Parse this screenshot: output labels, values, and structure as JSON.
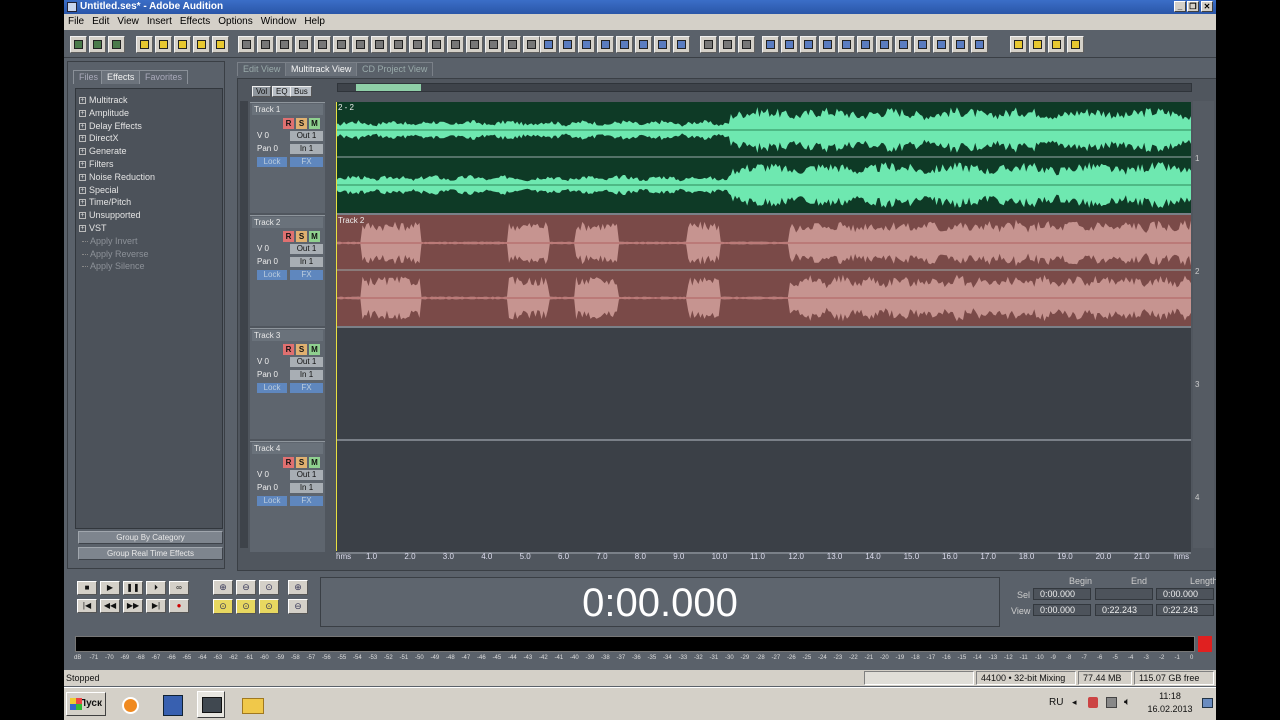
{
  "window": {
    "title": "Untitled.ses* - Adobe Audition",
    "controls": [
      "_",
      "❐",
      "✕"
    ]
  },
  "menu": [
    "File",
    "Edit",
    "View",
    "Insert",
    "Effects",
    "Options",
    "Window",
    "Help"
  ],
  "left_panel": {
    "tabs": [
      "Files",
      "Effects",
      "Favorites"
    ],
    "active_tab": "Effects",
    "tree": [
      {
        "label": "Multitrack",
        "expandable": true
      },
      {
        "label": "Amplitude",
        "expandable": true
      },
      {
        "label": "Delay Effects",
        "expandable": true
      },
      {
        "label": "DirectX",
        "expandable": true
      },
      {
        "label": "Generate",
        "expandable": true
      },
      {
        "label": "Filters",
        "expandable": true
      },
      {
        "label": "Noise Reduction",
        "expandable": true
      },
      {
        "label": "Special",
        "expandable": true
      },
      {
        "label": "Time/Pitch",
        "expandable": true
      },
      {
        "label": "Unsupported",
        "expandable": true
      },
      {
        "label": "VST",
        "expandable": true
      },
      {
        "label": "Apply Invert",
        "expandable": false
      },
      {
        "label": "Apply Reverse",
        "expandable": false
      },
      {
        "label": "Apply Silence",
        "expandable": false
      }
    ],
    "buttons": [
      "Group By Category",
      "Group Real Time Effects"
    ]
  },
  "view_tabs": [
    "Edit View",
    "Multitrack View",
    "CD Project View"
  ],
  "active_view": "Multitrack View",
  "track_header_modes": [
    "Vol",
    "EQ",
    "Bus"
  ],
  "tracks": [
    {
      "name": "Track 1",
      "vol": "V 0",
      "pan": "Pan 0",
      "out": "Out 1",
      "in": "In 1",
      "lock": "Lock",
      "fx": "FX",
      "clip": "2 - 2",
      "lane_number": "1",
      "clip_color": "#6ee8b0"
    },
    {
      "name": "Track 2",
      "vol": "V 0",
      "pan": "Pan 0",
      "out": "Out 1",
      "in": "In 1",
      "lock": "Lock",
      "fx": "FX",
      "clip": "Track 2",
      "lane_number": "2",
      "clip_color": "#c69490"
    },
    {
      "name": "Track 3",
      "vol": "V 0",
      "pan": "Pan 0",
      "out": "Out 1",
      "in": "In 1",
      "lock": "Lock",
      "fx": "FX",
      "clip": "",
      "lane_number": "3",
      "clip_color": ""
    },
    {
      "name": "Track 4",
      "vol": "V 0",
      "pan": "Pan 0",
      "out": "Out 1",
      "in": "In 1",
      "lock": "Lock",
      "fx": "FX",
      "clip": "",
      "lane_number": "4",
      "clip_color": ""
    }
  ],
  "track_buttons": [
    "R",
    "S",
    "M"
  ],
  "ruler": {
    "start": "hms",
    "end": "hms",
    "ticks": [
      "1.0",
      "2.0",
      "3.0",
      "4.0",
      "5.0",
      "6.0",
      "7.0",
      "8.0",
      "9.0",
      "10.0",
      "11.0",
      "12.0",
      "13.0",
      "14.0",
      "15.0",
      "16.0",
      "17.0",
      "18.0",
      "19.0",
      "20.0",
      "21.0"
    ]
  },
  "time_display": "0:00.000",
  "selection": {
    "headers": [
      "Begin",
      "End",
      "Length"
    ],
    "sel_label": "Sel",
    "view_label": "View",
    "sel": [
      "0:00.000",
      "",
      "0:00.000"
    ],
    "view": [
      "0:00.000",
      "0:22.243",
      "0:22.243"
    ]
  },
  "meter_scale": [
    "dB",
    "-71",
    "-70",
    "-69",
    "-68",
    "-67",
    "-66",
    "-65",
    "-64",
    "-63",
    "-62",
    "-61",
    "-60",
    "-59",
    "-58",
    "-57",
    "-56",
    "-55",
    "-54",
    "-53",
    "-52",
    "-51",
    "-50",
    "-49",
    "-48",
    "-47",
    "-46",
    "-45",
    "-44",
    "-43",
    "-42",
    "-41",
    "-40",
    "-39",
    "-38",
    "-37",
    "-36",
    "-35",
    "-34",
    "-33",
    "-32",
    "-31",
    "-30",
    "-29",
    "-28",
    "-27",
    "-26",
    "-25",
    "-24",
    "-23",
    "-22",
    "-21",
    "-20",
    "-19",
    "-18",
    "-17",
    "-16",
    "-15",
    "-14",
    "-13",
    "-12",
    "-11",
    "-10",
    "-9",
    "-8",
    "-7",
    "-6",
    "-5",
    "-4",
    "-3",
    "-2",
    "-1",
    "0"
  ],
  "status": {
    "state": "Stopped",
    "format": "44100 • 32-bit Mixing",
    "mem": "77.44 MB",
    "free": "115.07 GB free"
  },
  "taskbar": {
    "start": "Пуск",
    "lang": "RU",
    "time": "11:18",
    "date": "16.02.2013"
  }
}
